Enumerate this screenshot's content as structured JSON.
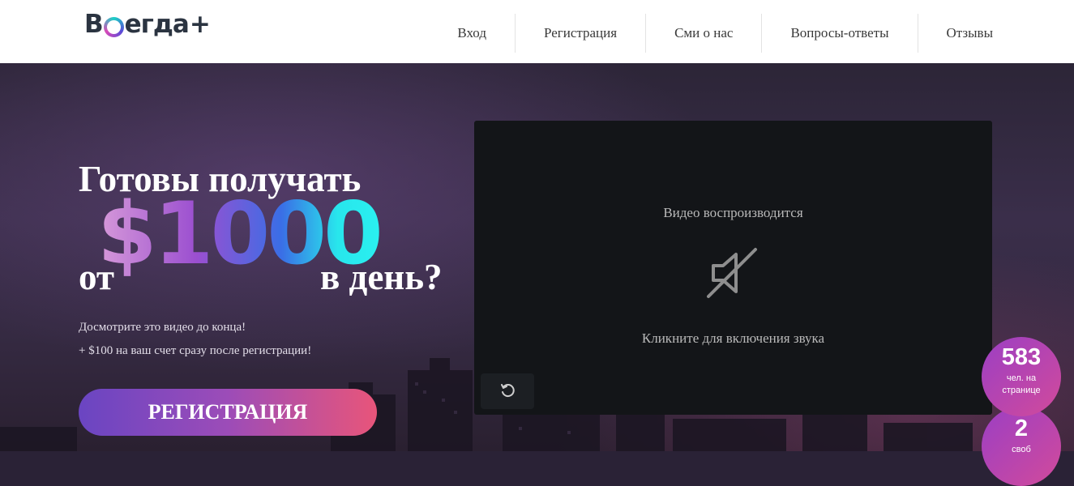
{
  "logo": {
    "text_left": "B",
    "text_right": "егда",
    "plus": "+"
  },
  "nav": {
    "items": [
      {
        "label": "Вход"
      },
      {
        "label": "Регистрация"
      },
      {
        "label": "Сми о нас"
      },
      {
        "label": "Вопросы-ответы"
      },
      {
        "label": "Отзывы"
      }
    ]
  },
  "hero": {
    "headline_line1": "Готовы получать",
    "headline_prefix": "от",
    "amount": "$1000",
    "headline_suffix": "в день?",
    "subtitle_1": "Досмотрите это видео до конца!",
    "subtitle_2": "+ $100 на ваш счет сразу после регистрации!",
    "register_label": "РЕГИСТРАЦИЯ"
  },
  "video": {
    "status": "Видео воспроизводится",
    "hint": "Кликните для включения звука",
    "icons": [
      "muted-speaker-icon",
      "replay-icon"
    ]
  },
  "counters": {
    "online_count": "583",
    "online_label": "чел. на странице",
    "free_count": "2",
    "free_label": "своб"
  },
  "colors": {
    "accent_purple": "#6a45c2",
    "accent_pink": "#e8557a",
    "video_bg": "#131518"
  }
}
